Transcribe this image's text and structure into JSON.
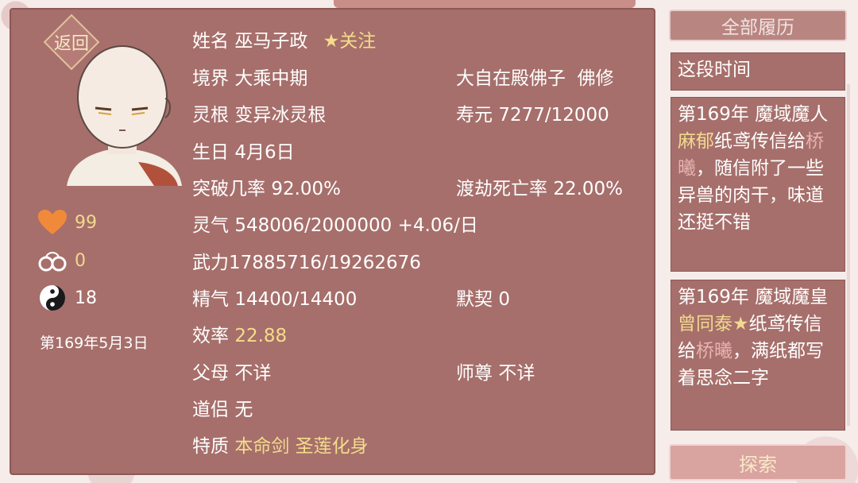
{
  "header": {
    "back_label": "返回"
  },
  "profile": {
    "name_label": "姓名",
    "name": "巫马子政",
    "follow_label": "关注",
    "realm_label": "境界",
    "realm": "大乘中期",
    "title": "大自在殿佛子",
    "sect_type": "佛修",
    "root_label": "灵根",
    "root": "变异冰灵根",
    "lifespan_label": "寿元",
    "lifespan": "7277/12000",
    "birthday_label": "生日",
    "birthday": "4月6日",
    "breakthrough_label": "突破几率",
    "breakthrough": "92.00%",
    "tribulation_label": "渡劫死亡率",
    "tribulation": "22.00%",
    "qi_label": "灵气",
    "qi": "548006/2000000 +4.06/日",
    "force_label": "武力",
    "force": "17885716/19262676",
    "essence_label": "精气",
    "essence": "14400/14400",
    "tacit_label": "默契",
    "tacit": "0",
    "efficiency_label": "效率",
    "efficiency": "22.88",
    "parents_label": "父母",
    "parents": "不详",
    "master_label": "师尊",
    "master": "不详",
    "partner_label": "道侣",
    "partner": "无",
    "traits_label": "特质",
    "traits": "本命剑 圣莲化身"
  },
  "stats": {
    "favor": "99",
    "bond": "0",
    "yinyang": "18",
    "date": "第169年5月3日"
  },
  "colors": {
    "panel": "#a66f6b",
    "gold": "#f4dc8c",
    "heart": "#f08a3a"
  },
  "history": {
    "button_label": "全部履历",
    "card0": {
      "text": "这段时间"
    },
    "card1": {
      "p1": "第169年 魔域魔人",
      "name": "麻郁",
      "p2": "纸鸢传信给",
      "target": "桥曦",
      "p3": "，随信附了一些异兽的肉干，味道还挺不错"
    },
    "card2": {
      "p1": "第169年 魔域魔皇",
      "name": "曾同泰★",
      "p2": "纸鸢传信给",
      "target": "桥曦",
      "p3": "，满纸都写着思念二字"
    },
    "explore_label": "探索"
  }
}
